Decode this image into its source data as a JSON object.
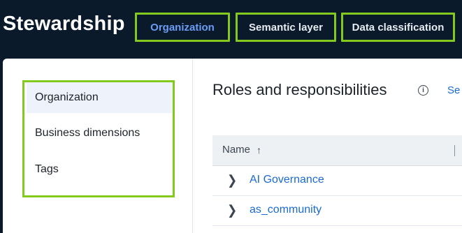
{
  "app": {
    "title": "Stewardship"
  },
  "tabs": [
    {
      "label": "Organization",
      "active": true
    },
    {
      "label": "Semantic layer",
      "active": false
    },
    {
      "label": "Data classification",
      "active": false
    }
  ],
  "sidebar": {
    "items": [
      {
        "label": "Organization",
        "selected": true
      },
      {
        "label": "Business dimensions",
        "selected": false
      },
      {
        "label": "Tags",
        "selected": false
      }
    ]
  },
  "main": {
    "title": "Roles and responsibilities",
    "link_partial": "Se",
    "info_icon": "info-icon",
    "table": {
      "header": {
        "name_label": "Name",
        "sort_icon": "arrow-up-icon"
      },
      "rows": [
        {
          "name": "AI Governance"
        },
        {
          "name": "as_community"
        }
      ]
    }
  },
  "colors": {
    "accent_link": "#1a6ad6",
    "active_tab": "#6b9cf5",
    "highlight_border": "#84c91e",
    "topbar_bg": "#0b1a2b"
  }
}
